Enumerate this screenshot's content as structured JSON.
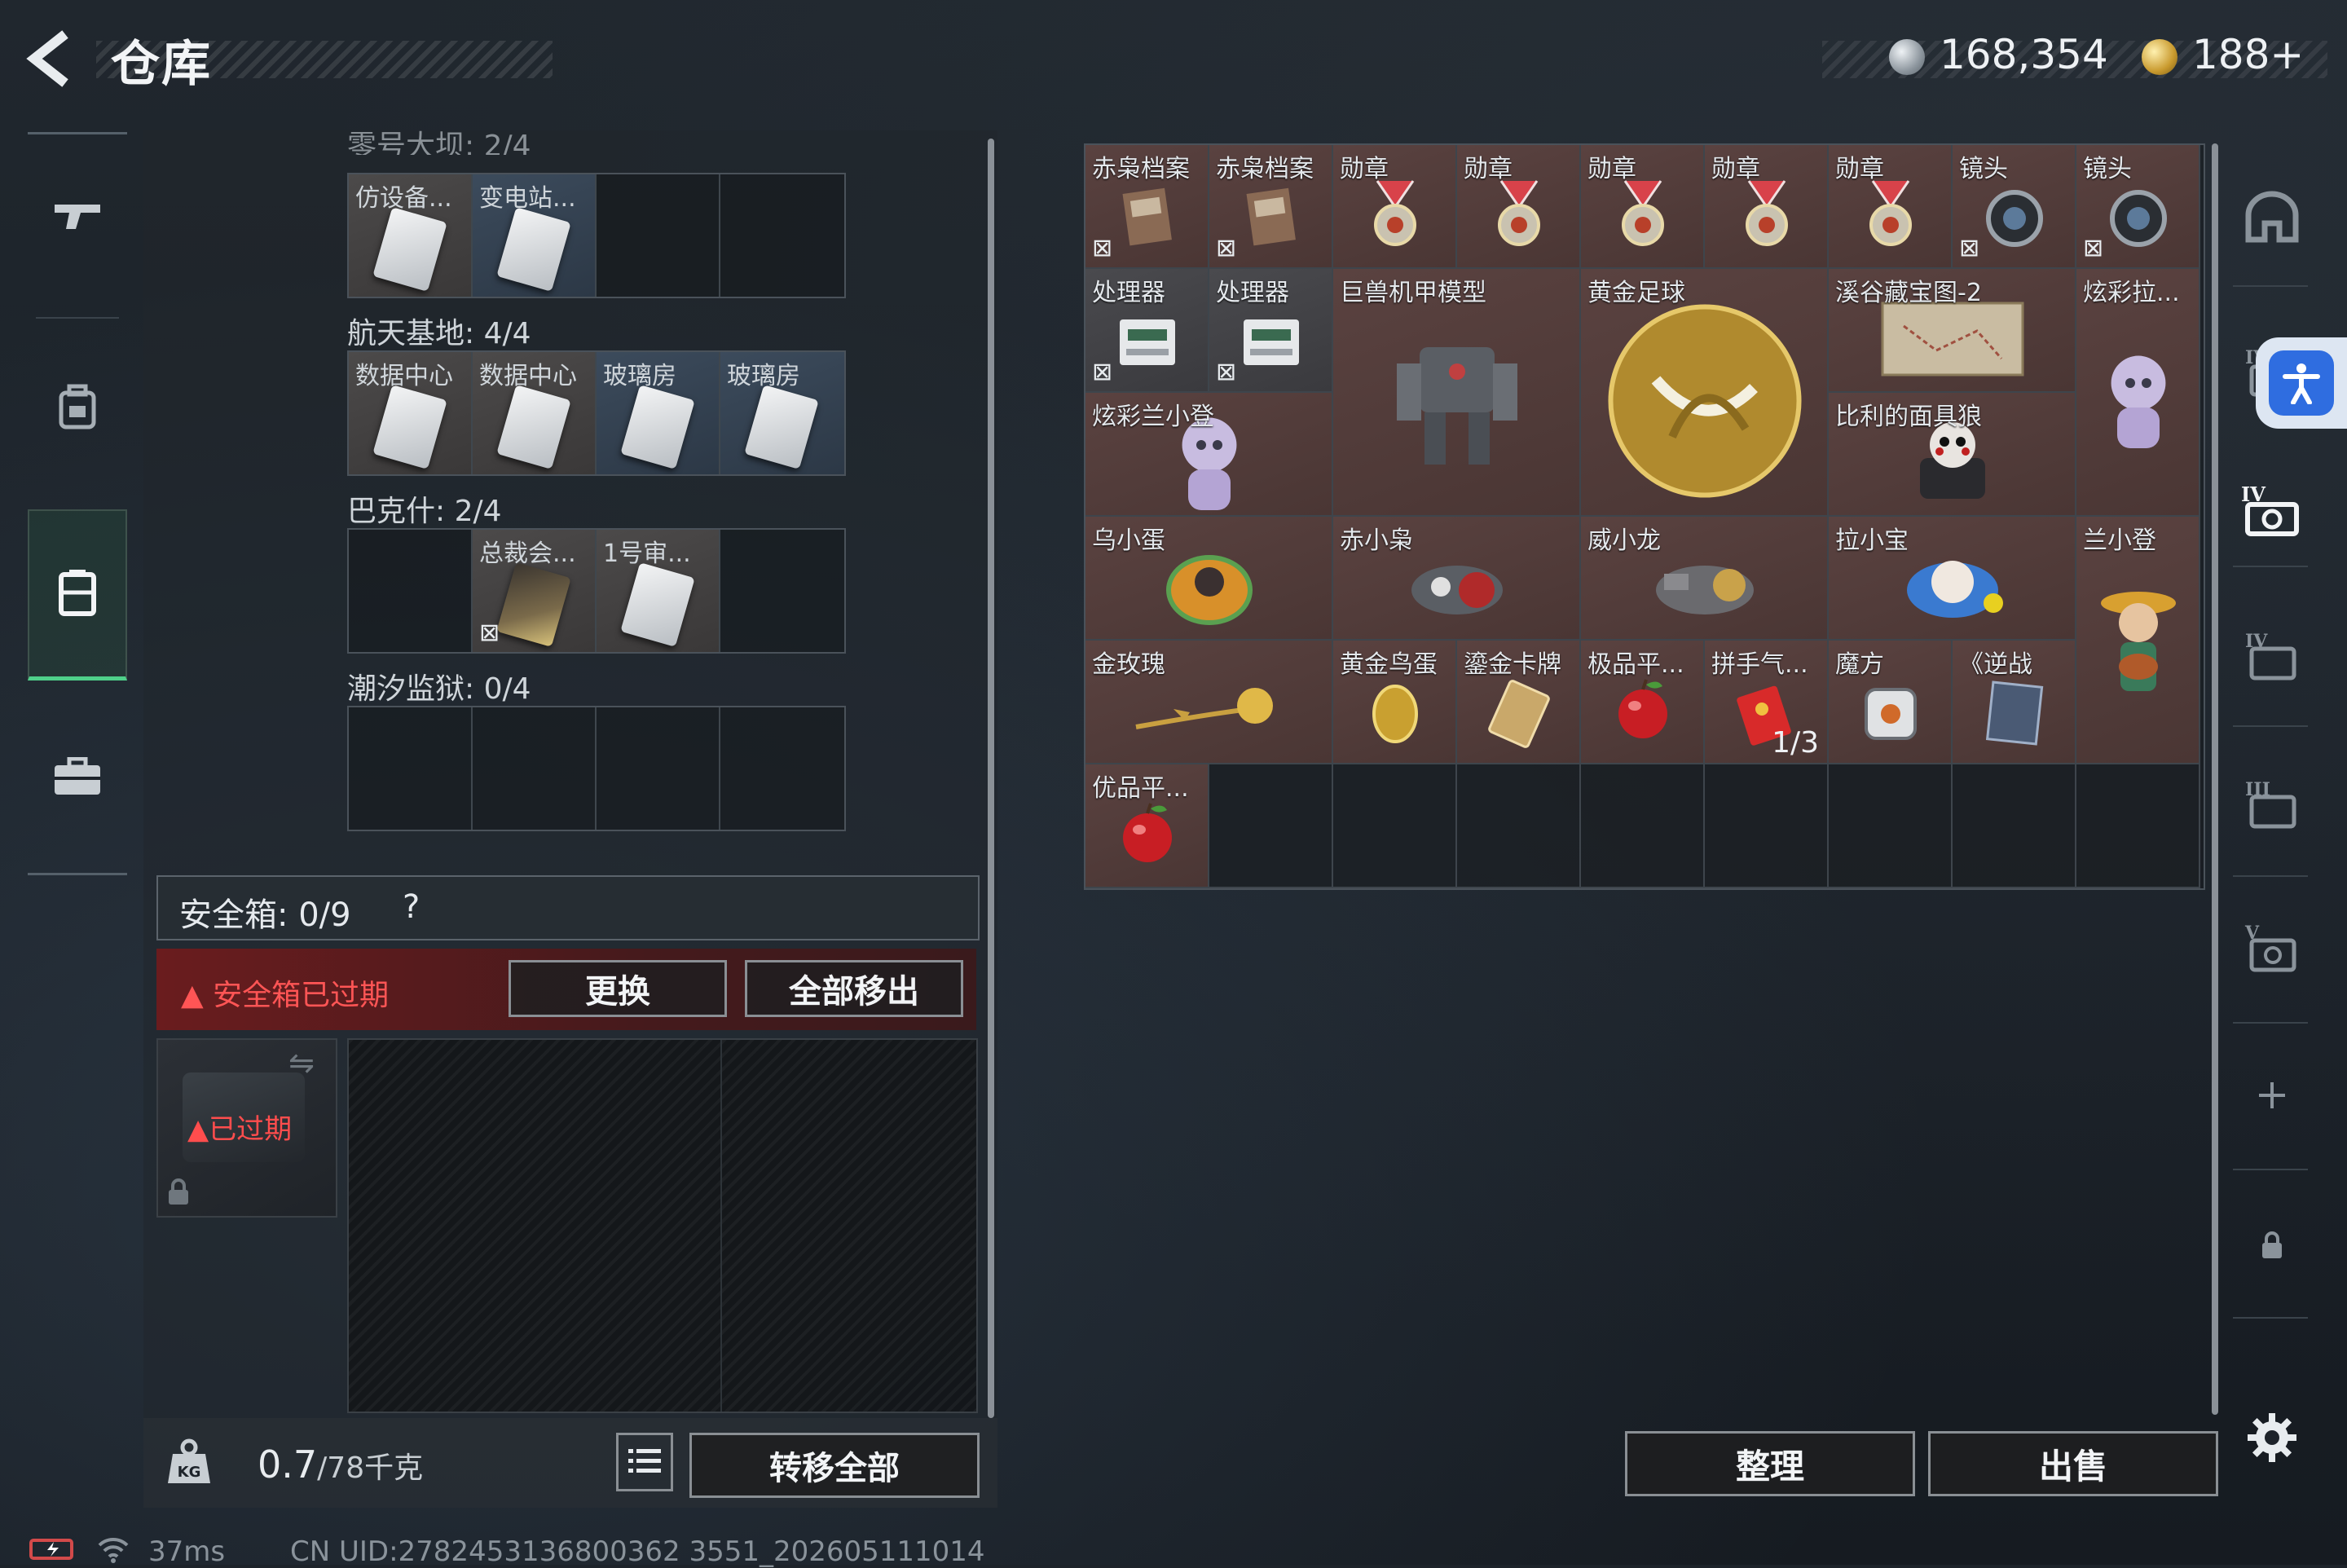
{
  "header": {
    "back_icon": "back-arrow-icon",
    "title": "仓库",
    "currency_silver": "168,354",
    "currency_gold": "188+"
  },
  "nav": {
    "items": [
      {
        "icon": "gun-icon"
      },
      {
        "icon": "backpack-icon"
      },
      {
        "icon": "storage-icon"
      },
      {
        "icon": "briefcase-icon"
      }
    ],
    "active_index": 2
  },
  "left": {
    "top_label_partial": "零号大坝: 2/4",
    "groups": [
      {
        "slots": [
          {
            "label": "仿设备...",
            "filled": true,
            "style": "gray"
          },
          {
            "label": "变电站...",
            "filled": true,
            "style": "blue"
          },
          {
            "label": "",
            "filled": false
          },
          {
            "label": "",
            "filled": false
          }
        ]
      },
      {
        "title": "航天基地: 4/4",
        "slots": [
          {
            "label": "数据中心",
            "filled": true,
            "style": "gray"
          },
          {
            "label": "数据中心",
            "filled": true,
            "style": "gray"
          },
          {
            "label": "玻璃房",
            "filled": true,
            "style": "blue"
          },
          {
            "label": "玻璃房",
            "filled": true,
            "style": "blue"
          }
        ]
      },
      {
        "title": "巴克什: 2/4",
        "slots": [
          {
            "label": "",
            "filled": false
          },
          {
            "label": "总裁会...",
            "filled": true,
            "style": "gray",
            "dark": true,
            "nolock": true
          },
          {
            "label": "1号审...",
            "filled": true,
            "style": "gray"
          },
          {
            "label": "",
            "filled": false
          }
        ]
      },
      {
        "title": "潮汐监狱: 0/4",
        "slots": [
          {
            "label": "",
            "filled": false
          },
          {
            "label": "",
            "filled": false
          },
          {
            "label": "",
            "filled": false
          },
          {
            "label": "",
            "filled": false
          }
        ]
      }
    ],
    "safe_box_label": "安全箱: 0/9",
    "safe_help": "?",
    "warning_text": "安全箱已过期",
    "replace_button": "更换",
    "remove_all_button": "全部移出",
    "expired_tag": "已过期",
    "weight_value": "0.7",
    "weight_unit": "/78千克",
    "transfer_all_button": "转移全部"
  },
  "inventory": {
    "items": [
      {
        "label": "赤枭档案",
        "c": 0,
        "r": 0,
        "w": 1,
        "h": 1,
        "color": "brown",
        "icon": "dossier-icon",
        "nolock": true
      },
      {
        "label": "赤枭档案",
        "c": 1,
        "r": 0,
        "w": 1,
        "h": 1,
        "color": "brown",
        "icon": "dossier-icon",
        "nolock": true
      },
      {
        "label": "勋章",
        "c": 2,
        "r": 0,
        "w": 1,
        "h": 1,
        "color": "brown",
        "icon": "medal-icon"
      },
      {
        "label": "勋章",
        "c": 3,
        "r": 0,
        "w": 1,
        "h": 1,
        "color": "brown",
        "icon": "medal-icon"
      },
      {
        "label": "勋章",
        "c": 4,
        "r": 0,
        "w": 1,
        "h": 1,
        "color": "brown",
        "icon": "medal-icon"
      },
      {
        "label": "勋章",
        "c": 5,
        "r": 0,
        "w": 1,
        "h": 1,
        "color": "brown",
        "icon": "medal-icon"
      },
      {
        "label": "勋章",
        "c": 6,
        "r": 0,
        "w": 1,
        "h": 1,
        "color": "brown",
        "icon": "medal-icon"
      },
      {
        "label": "镜头",
        "c": 7,
        "r": 0,
        "w": 1,
        "h": 1,
        "color": "brown",
        "icon": "lens-icon",
        "nolock": true
      },
      {
        "label": "镜头",
        "c": 8,
        "r": 0,
        "w": 1,
        "h": 1,
        "color": "brown",
        "icon": "lens-icon",
        "nolock": true
      },
      {
        "label": "处理器",
        "c": 0,
        "r": 1,
        "w": 1,
        "h": 1,
        "color": "gray",
        "icon": "processor-icon",
        "nolock": true
      },
      {
        "label": "处理器",
        "c": 1,
        "r": 1,
        "w": 1,
        "h": 1,
        "color": "gray",
        "icon": "processor-icon",
        "nolock": true
      },
      {
        "label": "巨兽机甲模型",
        "c": 2,
        "r": 1,
        "w": 2,
        "h": 2,
        "color": "brown",
        "icon": "mech-model-icon"
      },
      {
        "label": "黄金足球",
        "c": 4,
        "r": 1,
        "w": 2,
        "h": 2,
        "color": "brown",
        "icon": "golden-football-icon"
      },
      {
        "label": "溪谷藏宝图-2",
        "c": 6,
        "r": 1,
        "w": 2,
        "h": 1,
        "color": "brown",
        "icon": "treasure-map-icon"
      },
      {
        "label": "炫彩拉...",
        "c": 8,
        "r": 1,
        "w": 1,
        "h": 2,
        "color": "brown",
        "icon": "figurine-icon"
      },
      {
        "label": "炫彩兰小登",
        "c": 0,
        "r": 2,
        "w": 2,
        "h": 1,
        "color": "brown",
        "icon": "figurine-icon"
      },
      {
        "label": "比利的面具狼",
        "c": 6,
        "r": 2,
        "w": 2,
        "h": 1,
        "color": "brown",
        "icon": "mask-wolf-icon"
      },
      {
        "label": "乌小蛋",
        "c": 0,
        "r": 3,
        "w": 2,
        "h": 1,
        "color": "brown",
        "icon": "egg-figure-icon"
      },
      {
        "label": "赤小枭",
        "c": 2,
        "r": 3,
        "w": 2,
        "h": 1,
        "color": "brown",
        "icon": "owl-figure-icon"
      },
      {
        "label": "威小龙",
        "c": 4,
        "r": 3,
        "w": 2,
        "h": 1,
        "color": "brown",
        "icon": "dragon-figure-icon"
      },
      {
        "label": "拉小宝",
        "c": 6,
        "r": 3,
        "w": 2,
        "h": 1,
        "color": "brown",
        "icon": "doll-figure-icon"
      },
      {
        "label": "兰小登",
        "c": 8,
        "r": 3,
        "w": 1,
        "h": 2,
        "color": "brown",
        "icon": "guitar-figure-icon"
      },
      {
        "label": "金玫瑰",
        "c": 0,
        "r": 4,
        "w": 2,
        "h": 1,
        "color": "brown",
        "icon": "gold-rose-icon"
      },
      {
        "label": "黄金鸟蛋",
        "c": 2,
        "r": 4,
        "w": 1,
        "h": 1,
        "color": "brown",
        "icon": "golden-egg-icon"
      },
      {
        "label": "鎏金卡牌",
        "c": 3,
        "r": 4,
        "w": 1,
        "h": 1,
        "color": "brown",
        "icon": "gold-card-icon"
      },
      {
        "label": "极品平...",
        "c": 4,
        "r": 4,
        "w": 1,
        "h": 1,
        "color": "brown",
        "icon": "apple-icon"
      },
      {
        "label": "拼手气...",
        "c": 5,
        "r": 4,
        "w": 1,
        "h": 1,
        "color": "brown",
        "icon": "red-envelope-icon",
        "count": "1/3"
      },
      {
        "label": "魔方",
        "c": 6,
        "r": 4,
        "w": 1,
        "h": 1,
        "color": "brown",
        "icon": "cube-icon"
      },
      {
        "label": "《逆战",
        "c": 7,
        "r": 4,
        "w": 1,
        "h": 1,
        "color": "brown",
        "icon": "game-box-icon"
      },
      {
        "label": "优品平...",
        "c": 0,
        "r": 5,
        "w": 1,
        "h": 1,
        "color": "brown",
        "icon": "apple-icon"
      }
    ],
    "sort_button": "整理",
    "sell_button": "出售"
  },
  "right_nav": {
    "items": [
      "helmet-icon",
      "tier4-armor-icon",
      "tier4-chest-icon",
      "tier4-bag-icon",
      "tier3-bag-icon",
      "tier5-chest-icon",
      "add-icon",
      "lock-icon"
    ],
    "settings_icon": "gear-icon",
    "accessibility_icon": "accessibility-icon"
  },
  "status": {
    "ping": "37ms",
    "uid": "CN UID:2782453136800362 3551_202605111014"
  }
}
